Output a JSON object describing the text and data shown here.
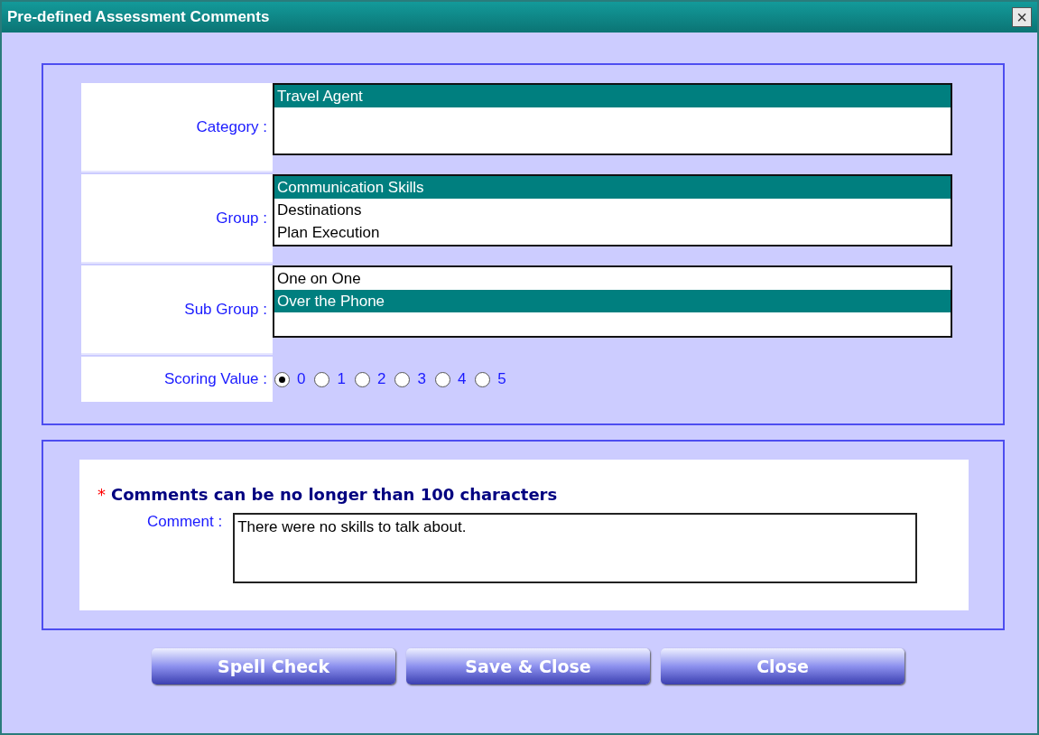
{
  "window": {
    "title": "Pre-defined Assessment Comments",
    "close_glyph": "×"
  },
  "fields": [
    {
      "label": "Category :",
      "options": [
        {
          "text": "Travel Agent",
          "selected": true
        }
      ]
    },
    {
      "label": "Group :",
      "options": [
        {
          "text": "Communication Skills",
          "selected": true
        },
        {
          "text": "Destinations",
          "selected": false
        },
        {
          "text": "Plan Execution",
          "selected": false
        }
      ]
    },
    {
      "label": "Sub Group :",
      "options": [
        {
          "text": "One on One",
          "selected": false
        },
        {
          "text": "Over the Phone",
          "selected": true
        }
      ]
    }
  ],
  "scoring": {
    "label": "Scoring Value :",
    "options": [
      {
        "text": "0",
        "selected": true
      },
      {
        "text": "1",
        "selected": false
      },
      {
        "text": "2",
        "selected": false
      },
      {
        "text": "3",
        "selected": false
      },
      {
        "text": "4",
        "selected": false
      },
      {
        "text": "5",
        "selected": false
      }
    ]
  },
  "comment_section": {
    "required_mark": "*",
    "note": "Comments can be no longer than 100 characters",
    "label": "Comment :",
    "value": "There were no skills to talk about."
  },
  "buttons": [
    "Spell Check",
    "Save & Close",
    "Close"
  ]
}
